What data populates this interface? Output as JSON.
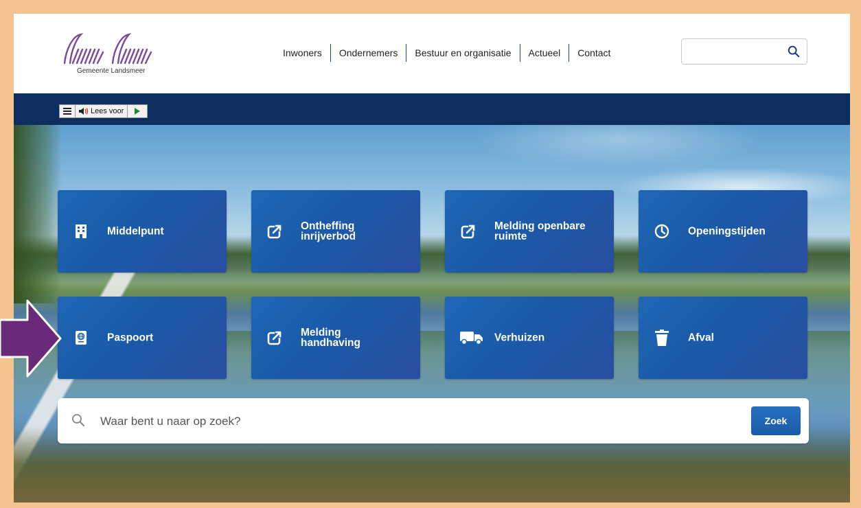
{
  "colors": {
    "frame": "#f3c48f",
    "navy": "#0c2d5e",
    "tile": "#1e66b4",
    "logo": "#7b4a9c",
    "arrow": "#6a2a7a"
  },
  "logo": {
    "caption": "Gemeente Landsmeer"
  },
  "nav": [
    {
      "label": "Inwoners"
    },
    {
      "label": "Ondernemers"
    },
    {
      "label": "Bestuur en organisatie"
    },
    {
      "label": "Actueel"
    },
    {
      "label": "Contact"
    }
  ],
  "header_search": {
    "value": "",
    "icon": "search-icon"
  },
  "readspeaker": {
    "menu_icon": "menu-icon",
    "speaker_icon": "speaker-icon",
    "label": "Lees voor",
    "play_icon": "play-icon"
  },
  "tiles": [
    {
      "label": "Middelpunt",
      "icon": "building-icon"
    },
    {
      "label": "Ontheffing inrijverbod",
      "icon": "external-link-icon"
    },
    {
      "label": "Melding openbare ruimte",
      "icon": "external-link-icon"
    },
    {
      "label": "Openingstijden",
      "icon": "clock-icon"
    },
    {
      "label": "Paspoort",
      "icon": "passport-icon"
    },
    {
      "label": "Melding handhaving",
      "icon": "external-link-icon"
    },
    {
      "label": "Verhuizen",
      "icon": "truck-icon"
    },
    {
      "label": "Afval",
      "icon": "trash-icon"
    }
  ],
  "search": {
    "placeholder": "Waar bent u naar op zoek?",
    "button_label": "Zoek"
  },
  "annotation": {
    "arrow": "pointing-right-arrow"
  }
}
